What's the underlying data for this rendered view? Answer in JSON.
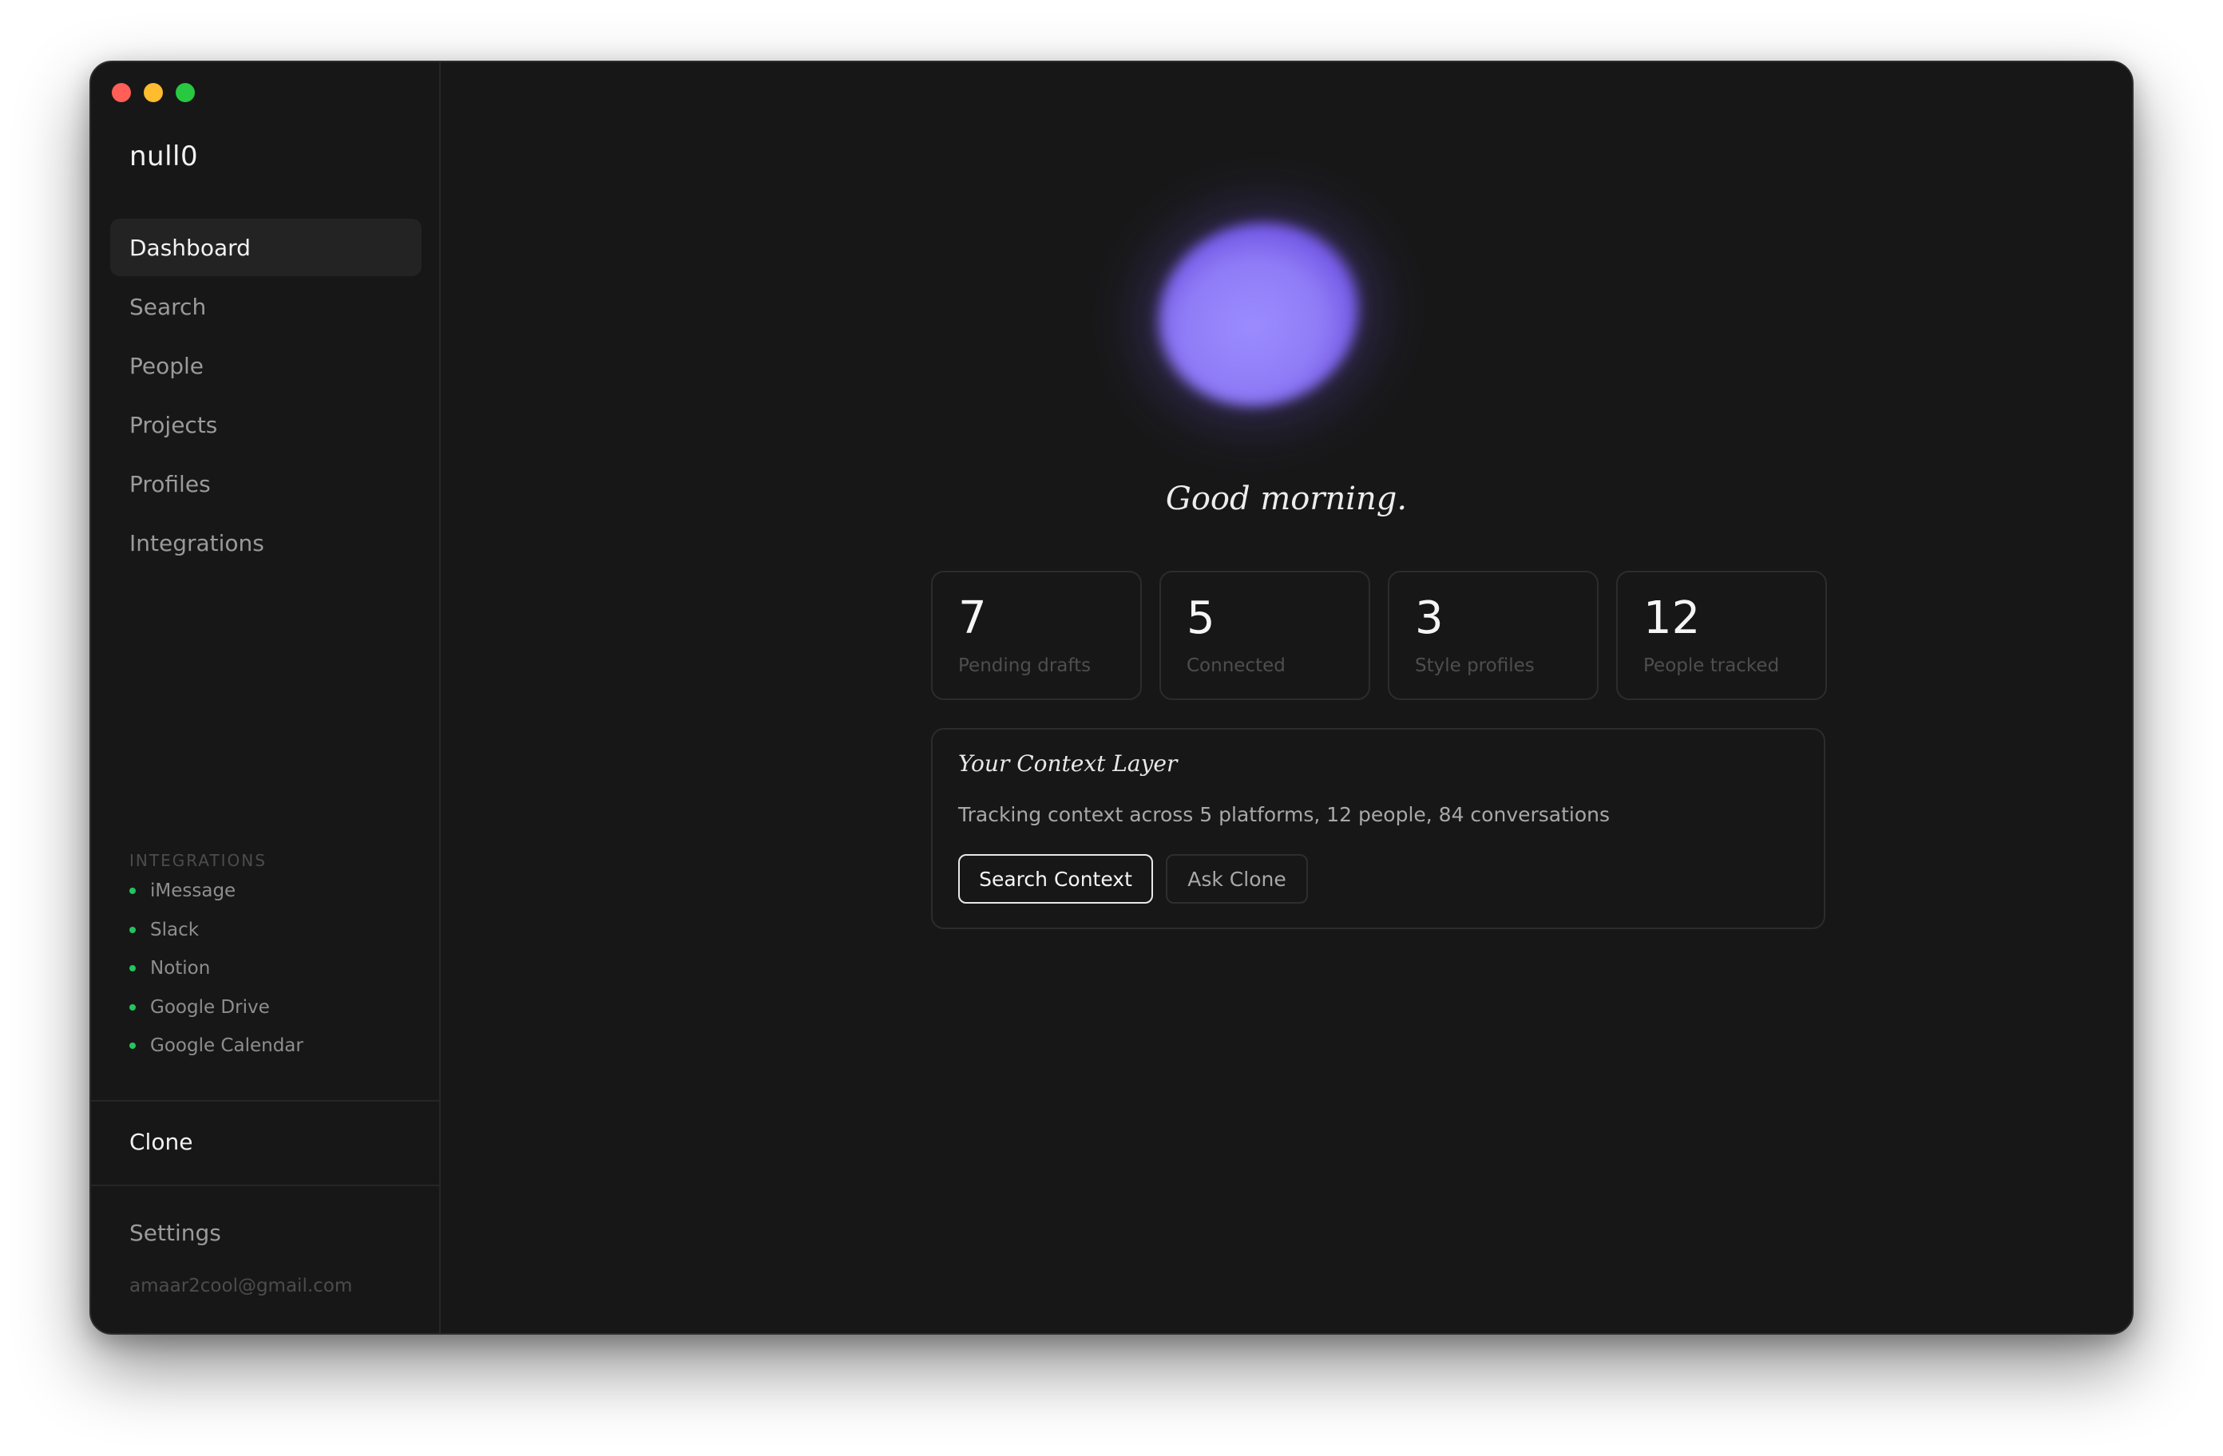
{
  "app": {
    "name": "null0"
  },
  "sidebar": {
    "nav": [
      {
        "label": "Dashboard",
        "active": true
      },
      {
        "label": "Search"
      },
      {
        "label": "People"
      },
      {
        "label": "Projects"
      },
      {
        "label": "Profiles"
      },
      {
        "label": "Integrations"
      }
    ],
    "integrations_title": "INTEGRATIONS",
    "integrations": [
      {
        "label": "iMessage",
        "status_color": "#22c55e"
      },
      {
        "label": "Slack",
        "status_color": "#22c55e"
      },
      {
        "label": "Notion",
        "status_color": "#22c55e"
      },
      {
        "label": "Google Drive",
        "status_color": "#22c55e"
      },
      {
        "label": "Google Calendar",
        "status_color": "#22c55e"
      }
    ],
    "clone_label": "Clone",
    "settings_label": "Settings",
    "email": "amaar2cool@gmail.com"
  },
  "main": {
    "greeting": "Good morning.",
    "stats": [
      {
        "value": "7",
        "label": "Pending drafts"
      },
      {
        "value": "5",
        "label": "Connected"
      },
      {
        "value": "3",
        "label": "Style profiles"
      },
      {
        "value": "12",
        "label": "People tracked"
      }
    ],
    "context": {
      "title": "Your Context Layer",
      "description": "Tracking context across 5 platforms, 12 people, 84 conversations",
      "primary_button": "Search Context",
      "secondary_button": "Ask Clone"
    }
  },
  "colors": {
    "background": "#171717",
    "accent_orb": "#8f7cf6",
    "status_green": "#22c55e"
  }
}
